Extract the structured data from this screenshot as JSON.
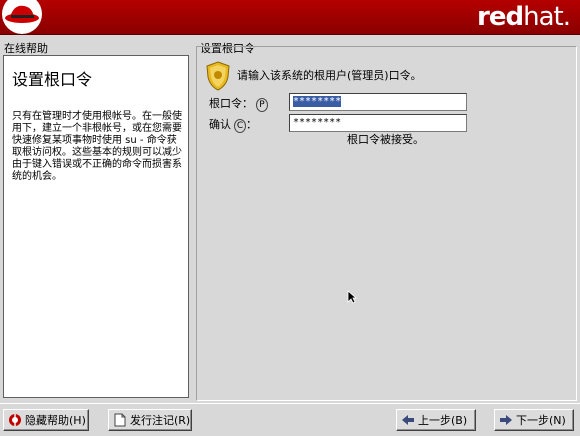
{
  "header": {
    "brand_bold": "red",
    "brand_thin": "hat."
  },
  "help": {
    "caption": "在线帮助",
    "title": "设置根口令",
    "body": "只有在管理时才使用根帐号。在一般使用下，建立一个非根帐号，或在您需要快速修复某项事物时使用 su - 命令获取根访问权。这些基本的规则可以减少由于键入错误或不正确的命令而损害系统的机会。"
  },
  "main": {
    "caption": "设置根口令",
    "prompt": "请输入该系统的根用户(管理员)口令。",
    "root_label": "根口令：",
    "root_mnemonic": "P",
    "root_value": "********",
    "confirm_label": "确认",
    "confirm_mnemonic": "C",
    "confirm_suffix": "：",
    "confirm_value": "********",
    "status": "根口令被接受。"
  },
  "buttons": {
    "hide_help": "隐藏帮助(H)",
    "release_notes": "发行注记(R)",
    "back": "上一步(B)",
    "next": "下一步(N)"
  },
  "colors": {
    "brand_red": "#a00000",
    "selection": "#3a5ea6"
  }
}
